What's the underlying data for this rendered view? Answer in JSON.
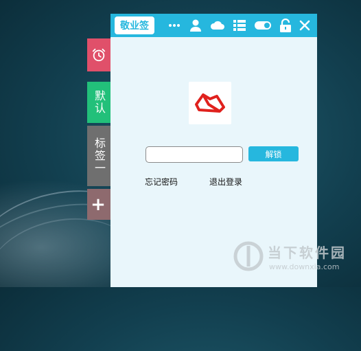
{
  "side_tabs": {
    "default_label": "默认",
    "note1_label": "标签一",
    "add_label": "+"
  },
  "window": {
    "brand": "敬业签",
    "unlock_label": "解锁",
    "forgot_label": "忘记密码",
    "logout_label": "退出登录",
    "password_value": ""
  },
  "watermark": {
    "name": "当下软件园",
    "url": "www.downxia.com"
  },
  "colors": {
    "titlebar": "#26b7de",
    "alarm_tab": "#e0506a",
    "default_tab": "#22c07a",
    "note_tab": "#6f6f6f",
    "add_tab": "#8e6a6e",
    "logo_red": "#e0211d"
  },
  "icons": [
    "alarm-clock-icon",
    "more-icon",
    "user-icon",
    "cloud-icon",
    "list-icon",
    "toggle-icon",
    "lock-icon",
    "close-icon",
    "app-logo-icon"
  ]
}
